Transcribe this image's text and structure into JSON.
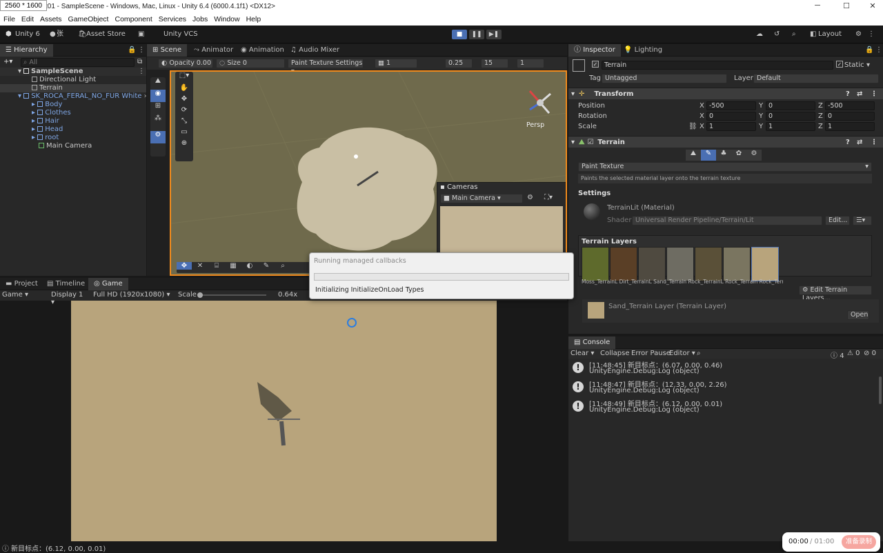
{
  "window": {
    "size_badge": "2560 * 1600",
    "title": "t01 - SampleScene - Windows, Mac, Linux - Unity 6.4 (6000.4.1f1) <DX12>",
    "min": "─",
    "max": "☐",
    "close": "✕"
  },
  "menu": [
    "File",
    "Edit",
    "Assets",
    "GameObject",
    "Component",
    "Services",
    "Jobs",
    "Window",
    "Help"
  ],
  "toolbar": {
    "account": "Unity 6",
    "user": "张",
    "asset_store": "Asset Store",
    "vcs": "Unity VCS",
    "layout": "Layout"
  },
  "hierarchy": {
    "tab": "Hierarchy",
    "search_placeholder": "All",
    "scene": "SampleScene",
    "items": [
      {
        "label": "Directional Light"
      },
      {
        "label": "Terrain"
      },
      {
        "label": "SK_ROCA_FERAL_NO_FUR White"
      },
      {
        "label": "Body"
      },
      {
        "label": "Clothes"
      },
      {
        "label": "Hair"
      },
      {
        "label": "Head"
      },
      {
        "label": "root"
      },
      {
        "label": "Main Camera"
      }
    ]
  },
  "scene_tabs": [
    "Scene",
    "Animator",
    "Animation",
    "Audio Mixer"
  ],
  "scene_toolbar": {
    "opacity": "Opacity 0.00",
    "size": "Size 0",
    "paint_settings": "Paint Texture Settings",
    "grid_val": "1",
    "v1": "0.25",
    "v2": "15",
    "v3": "1"
  },
  "gizmo": {
    "persp": "Persp"
  },
  "cameras_overlay": {
    "title": "Cameras",
    "camera": "Main Camera"
  },
  "progress": {
    "title": "Running managed callbacks",
    "status": "Initializing InitializeOnLoad Types",
    "progress": 0.0
  },
  "bottom_tabs": [
    "Project",
    "Timeline",
    "Game"
  ],
  "game_toolbar": {
    "mode": "Game",
    "display": "Display 1",
    "resolution": "Full HD (1920x1080)",
    "scale_label": "Scale",
    "scale_value": "0.64x"
  },
  "inspector": {
    "tabs": [
      "Inspector",
      "Lighting"
    ],
    "name": "Terrain",
    "static": "Static",
    "tag_label": "Tag",
    "tag_value": "Untagged",
    "layer_label": "Layer",
    "layer_value": "Default",
    "transform": {
      "title": "Transform",
      "rows": [
        {
          "label": "Position",
          "x": "-500",
          "y": "0",
          "z": "-500"
        },
        {
          "label": "Rotation",
          "x": "0",
          "y": "0",
          "z": "0"
        },
        {
          "label": "Scale",
          "x": "1",
          "y": "1",
          "z": "1"
        }
      ]
    },
    "terrain": {
      "title": "Terrain",
      "tool": "Paint Texture",
      "hint": "Paints the selected material layer onto the terrain texture",
      "settings": "Settings",
      "material": "TerrainLit (Material)",
      "shader_label": "Shader",
      "shader": "Universal Render Pipeline/Terrain/Lit",
      "edit": "Edit...",
      "layers_title": "Terrain Layers",
      "layer_names": "Moss_TerrainL Dirt_TerrainL Sand_Terrain Rock_TerrainL Rock_Terrain Rock_TerrainL Sand_TerrainLa",
      "edit_layers": "Edit Terrain Layers...",
      "selected_layer": "Sand_Terrain Layer (Terrain Layer)",
      "open": "Open"
    }
  },
  "console": {
    "tab": "Console",
    "clear": "Clear",
    "collapse": "Collapse",
    "error_pause": "Error Pause",
    "editor": "Editor",
    "count_info": "4",
    "count_warn": "0",
    "count_err": "0",
    "logs": [
      {
        "line1": "[11:48:45] 新目标点：(6.07, 0.00, 0.46)",
        "line2": "UnityEngine.Debug:Log (object)"
      },
      {
        "line1": "[11:48:47] 新目标点：(12.33, 0.00, 2.26)",
        "line2": "UnityEngine.Debug:Log (object)"
      },
      {
        "line1": "[11:48:49] 新目标点：(6.12, 0.00, 0.01)",
        "line2": "UnityEngine.Debug:Log (object)"
      }
    ]
  },
  "statusbar": {
    "text": "新目标点：(6.12, 0.00, 0.01)"
  },
  "recorder": {
    "time": "00:00",
    "total": "/ 01:00",
    "button": "准备录制"
  },
  "colors": {
    "accent": "#4a6fb3",
    "scene_border": "#f08a1c",
    "terrain_sand": "#b8a47c"
  }
}
